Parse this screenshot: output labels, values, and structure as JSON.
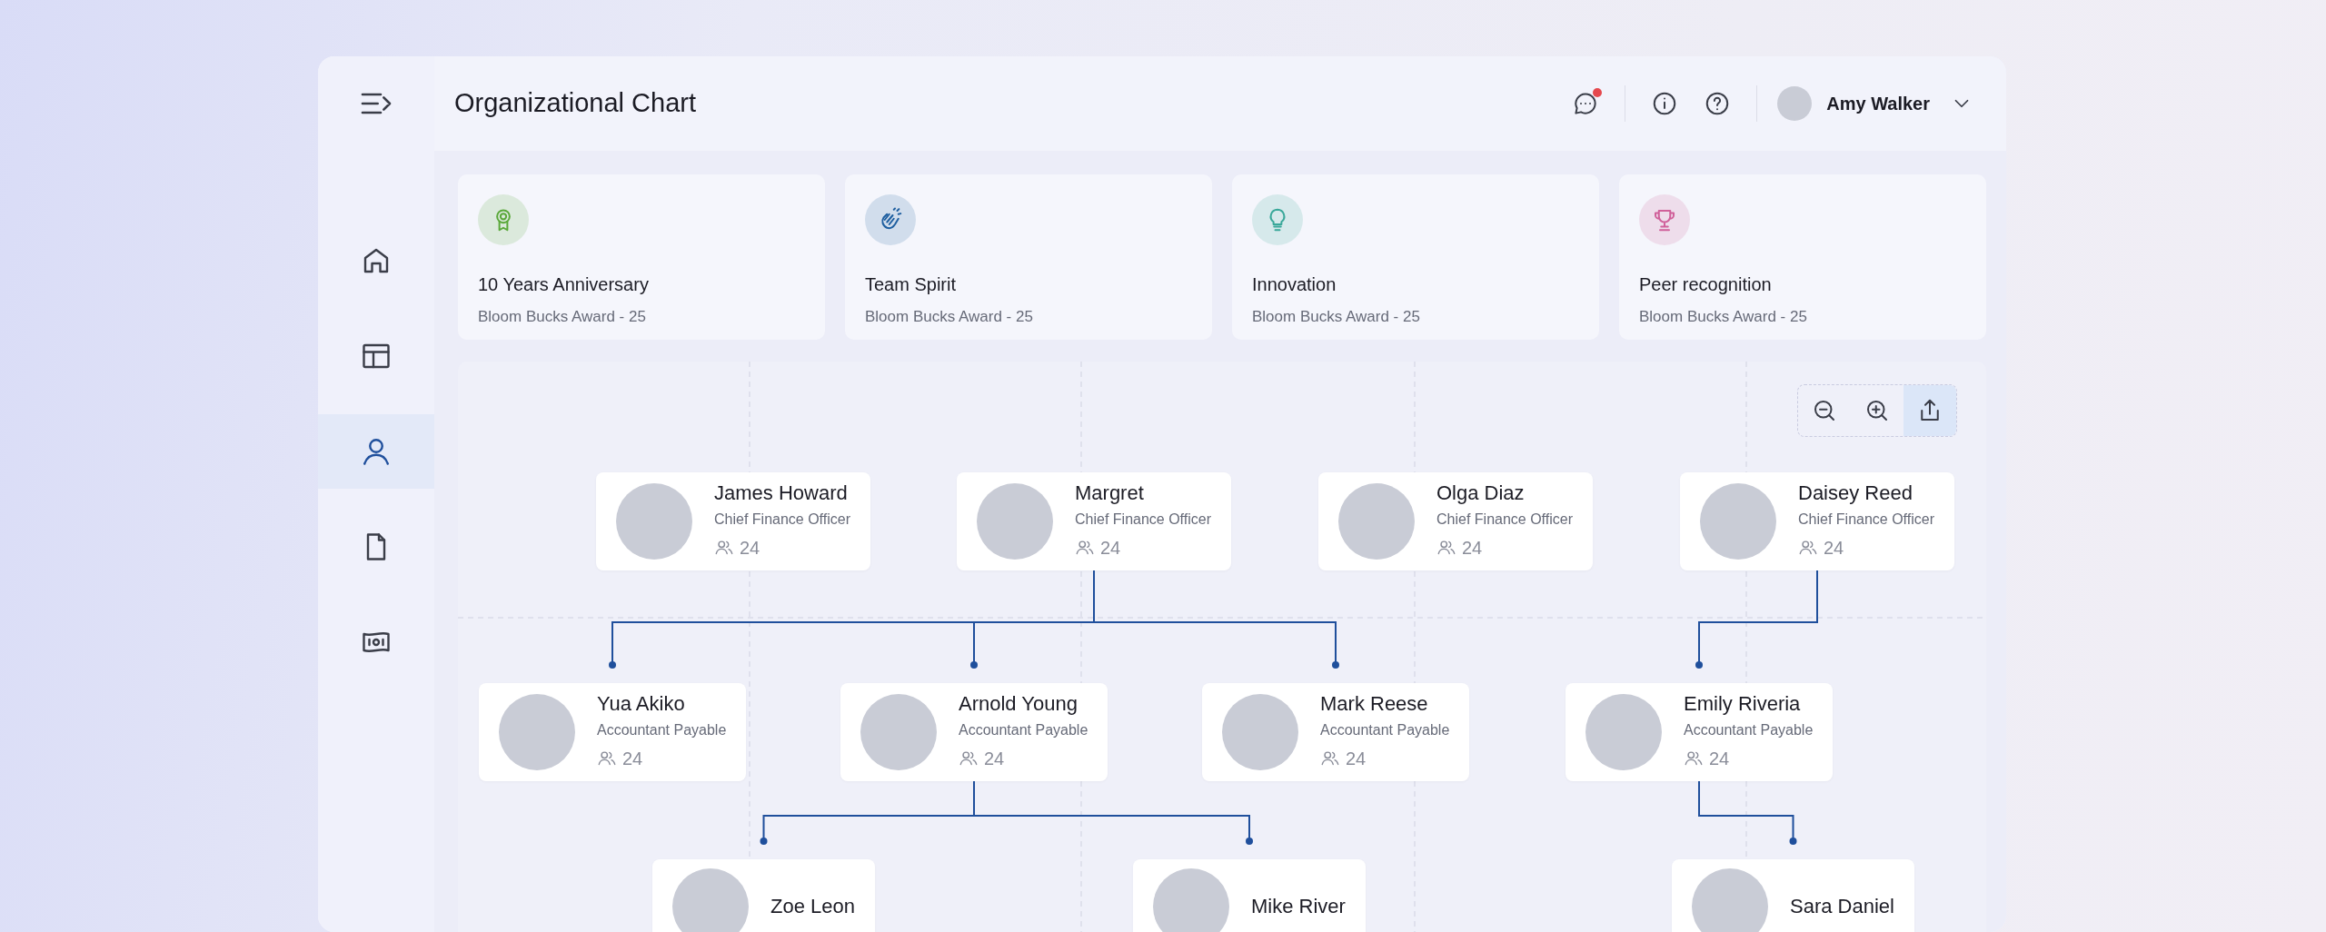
{
  "header": {
    "title": "Organizational Chart",
    "notification": true,
    "user": {
      "name": "Amy Walker"
    }
  },
  "sidebar": {
    "items": [
      {
        "kind": "home",
        "selected": false
      },
      {
        "kind": "layout",
        "selected": false
      },
      {
        "kind": "person",
        "selected": true
      },
      {
        "kind": "document",
        "selected": false
      },
      {
        "kind": "money",
        "selected": false
      }
    ]
  },
  "awards": [
    {
      "kind": "ribbon",
      "color": "#5aa83a",
      "title": "10 Years Anniversary",
      "subtitle": "Bloom Bucks Award - 25"
    },
    {
      "kind": "clap",
      "color": "#1f5fa0",
      "title": "Team Spirit",
      "subtitle": "Bloom Bucks Award - 25"
    },
    {
      "kind": "bulb",
      "color": "#3aa89a",
      "title": "Innovation",
      "subtitle": "Bloom Bucks Award - 25"
    },
    {
      "kind": "trophy",
      "color": "#d0609a",
      "title": "Peer recognition",
      "subtitle": "Bloom Bucks Award - 25"
    }
  ],
  "chart": {
    "toolbar": [
      {
        "kind": "zoom-out",
        "selected": false
      },
      {
        "kind": "zoom-in",
        "selected": false
      },
      {
        "kind": "share",
        "selected": true
      }
    ],
    "nodes": [
      {
        "name": "James Howard",
        "role": "Chief Finance Officer",
        "count": "24"
      },
      {
        "name": "Margret",
        "role": "Chief Finance Officer",
        "count": "24",
        "children": [
          {
            "name": "Yua Akiko",
            "role": "Accountant Payable",
            "count": "24"
          },
          {
            "name": "Arnold Young",
            "role": "Accountant Payable",
            "count": "24",
            "children": [
              {
                "name": "Zoe Leon"
              },
              {
                "name": "Mike River"
              }
            ]
          },
          {
            "name": "Mark Reese",
            "role": "Accountant Payable",
            "count": "24"
          }
        ]
      },
      {
        "name": "Olga Diaz",
        "role": "Chief Finance Officer",
        "count": "24"
      },
      {
        "name": "Daisey Reed",
        "role": "Chief Finance Officer",
        "count": "24",
        "children": [
          {
            "name": "Emily Riveria",
            "role": "Accountant Payable",
            "count": "24",
            "children": [
              {
                "name": "Sara Daniel"
              }
            ]
          }
        ]
      }
    ]
  }
}
